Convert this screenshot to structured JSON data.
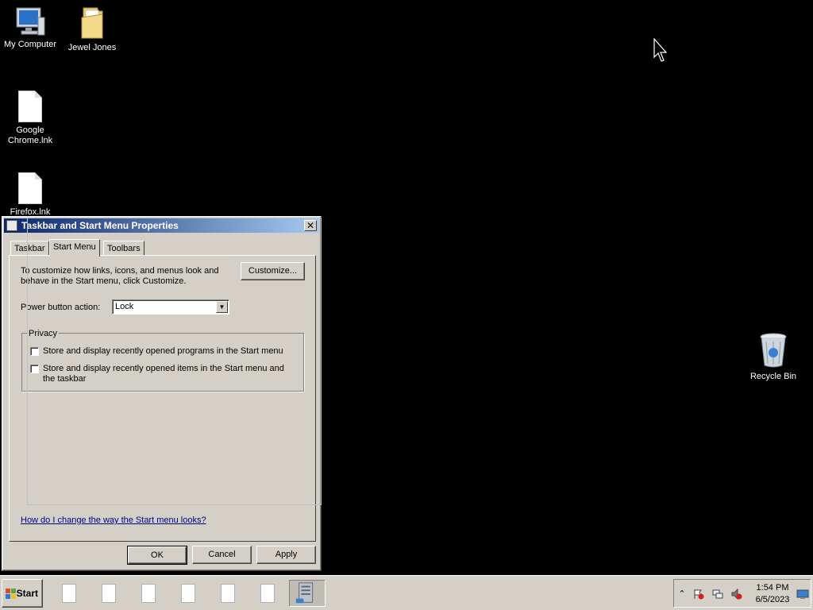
{
  "desktop": {
    "icons": [
      {
        "label": "My Computer",
        "icon": "computer-icon"
      },
      {
        "label": "Jewel Jones",
        "icon": "folder-icon"
      },
      {
        "label": "Google Chrome.lnk",
        "icon": "file-icon"
      },
      {
        "label": "Firefox.lnk",
        "icon": "file-icon"
      },
      {
        "label": "Recycle Bin",
        "icon": "recycle-bin-icon"
      }
    ]
  },
  "dialog": {
    "title": "Taskbar and Start Menu Properties",
    "close_label": "✕",
    "tabs": [
      {
        "label": "Taskbar"
      },
      {
        "label": "Start Menu",
        "active": true
      },
      {
        "label": "Toolbars"
      }
    ],
    "customize_text": "To customize how links, icons, and menus look and behave in the Start menu, click Customize.",
    "customize_button": "Customize...",
    "power_label": "Power button action:",
    "power_value": "Lock",
    "privacy": {
      "legend": "Privacy",
      "options": [
        {
          "label": "Store and display recently opened programs in the Start menu",
          "checked": false
        },
        {
          "label": "Store and display recently opened items in the Start menu and the taskbar",
          "checked": false
        }
      ]
    },
    "help_link": "How do I change the way the Start menu looks?",
    "buttons": {
      "ok": "OK",
      "cancel": "Cancel",
      "apply": "Apply"
    }
  },
  "taskbar": {
    "start_label": "Start",
    "items": [
      {
        "icon": "file-icon"
      },
      {
        "icon": "file-icon"
      },
      {
        "icon": "file-icon"
      },
      {
        "icon": "file-icon"
      },
      {
        "icon": "file-icon"
      },
      {
        "icon": "file-icon"
      },
      {
        "icon": "server-icon",
        "active": true
      }
    ],
    "tray": {
      "expand_icon": "chevron-up-icon",
      "icons": [
        "action-center-flag-icon",
        "network-icon",
        "volume-muted-icon"
      ],
      "time": "1:54 PM",
      "date": "6/5/2023"
    }
  },
  "colors": {
    "desktop_bg": "#000000",
    "dialog_face": "#d4d0c8",
    "titlebar_start": "#0a246a",
    "titlebar_end": "#a6caf0",
    "link": "#000080"
  }
}
